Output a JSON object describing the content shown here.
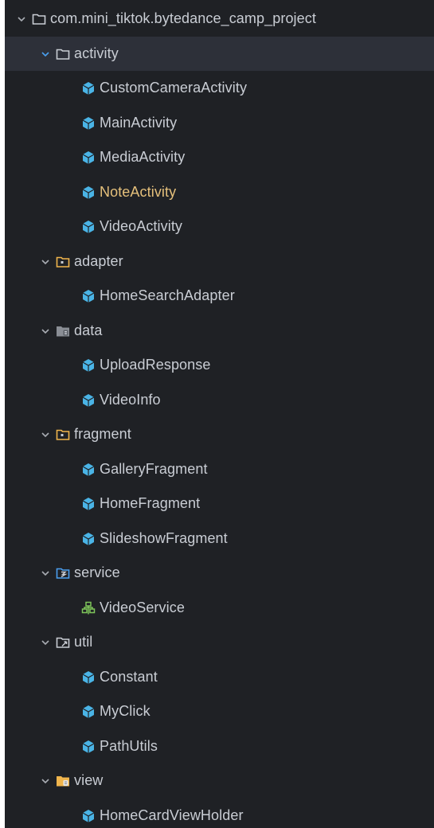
{
  "colors": {
    "panel_background": "#1f2125",
    "selected_row": "#2d3039",
    "text": "#c9cdd4",
    "highlighted_text": "#e5c07b",
    "class_icon": "#4ab4e6",
    "service_icon": "#7ec55a",
    "folder_accent": "#f0b54d"
  },
  "tree": {
    "root": {
      "label": "com.mini_tiktok.bytedance_camp_project",
      "icon": "folder-outline-icon"
    },
    "items": [
      {
        "label": "activity",
        "icon": "folder-outline-icon",
        "selected": true
      },
      {
        "label": "CustomCameraActivity",
        "icon": "class-icon"
      },
      {
        "label": "MainActivity",
        "icon": "class-icon"
      },
      {
        "label": "MediaActivity",
        "icon": "class-icon"
      },
      {
        "label": "NoteActivity",
        "icon": "class-icon",
        "highlighted": true
      },
      {
        "label": "VideoActivity",
        "icon": "class-icon"
      },
      {
        "label": "adapter",
        "icon": "package-folder-icon"
      },
      {
        "label": "HomeSearchAdapter",
        "icon": "class-icon"
      },
      {
        "label": "data",
        "icon": "data-folder-icon"
      },
      {
        "label": "UploadResponse",
        "icon": "class-icon"
      },
      {
        "label": "VideoInfo",
        "icon": "class-icon"
      },
      {
        "label": "fragment",
        "icon": "package-folder-icon"
      },
      {
        "label": "GalleryFragment",
        "icon": "class-icon"
      },
      {
        "label": "HomeFragment",
        "icon": "class-icon"
      },
      {
        "label": "SlideshowFragment",
        "icon": "class-icon"
      },
      {
        "label": "service",
        "icon": "service-folder-icon"
      },
      {
        "label": "VideoService",
        "icon": "service-icon"
      },
      {
        "label": "util",
        "icon": "util-folder-icon"
      },
      {
        "label": "Constant",
        "icon": "class-icon"
      },
      {
        "label": "MyClick",
        "icon": "class-icon"
      },
      {
        "label": "PathUtils",
        "icon": "class-icon"
      },
      {
        "label": "view",
        "icon": "view-folder-icon"
      },
      {
        "label": "HomeCardViewHolder",
        "icon": "class-icon"
      }
    ]
  }
}
